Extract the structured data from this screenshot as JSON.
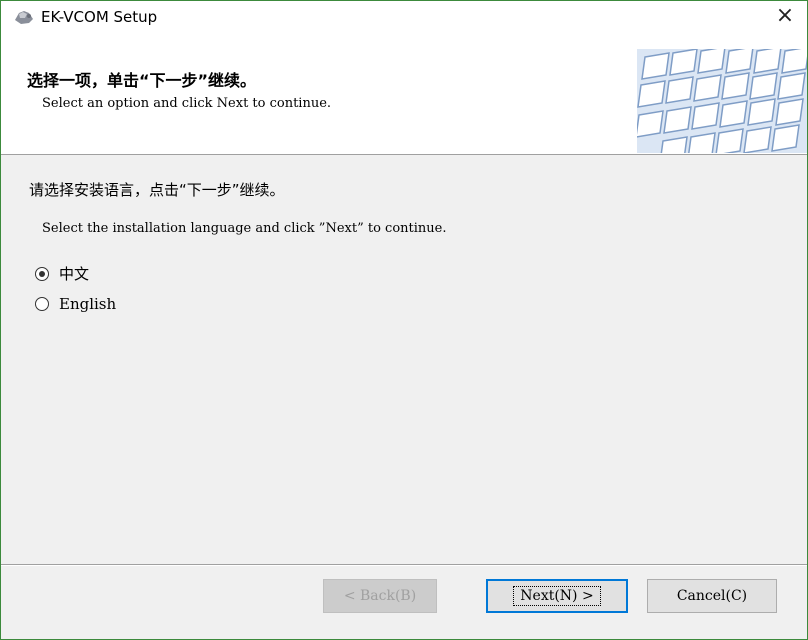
{
  "window": {
    "title": "EK-VCOM Setup",
    "close_glyph": "×",
    "app_icon": "setup-icon"
  },
  "header": {
    "title": "选择一项，单击“下一步”继续。",
    "subtitle": "Select an option and click Next to continue.",
    "banner_image": "keyboard-image"
  },
  "content": {
    "instruction_cn": "请选择安装语言，点击“下一步”继续。",
    "instruction_en": "Select the installation language and click ”Next” to continue.",
    "options": [
      {
        "label": "中文",
        "selected": true
      },
      {
        "label": "English",
        "selected": false
      }
    ]
  },
  "buttons": {
    "back": "< Back(B)",
    "next": "Next(N) >",
    "cancel": "Cancel(C)"
  }
}
